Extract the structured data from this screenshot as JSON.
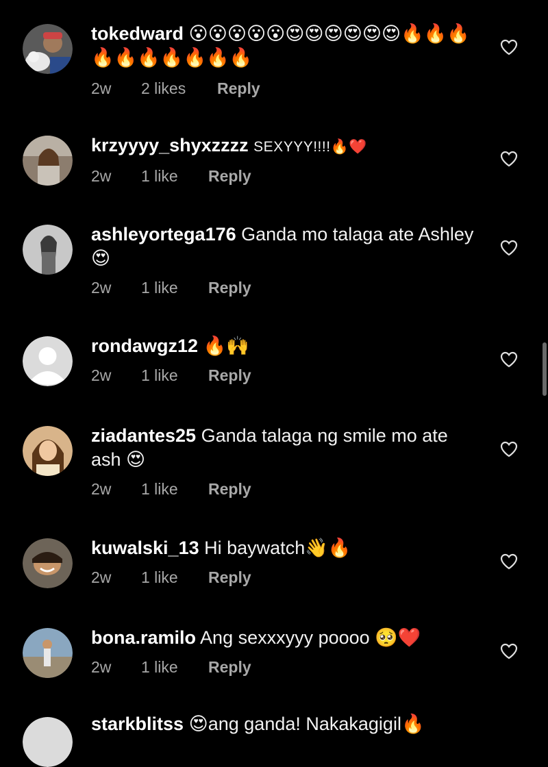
{
  "comments": [
    {
      "username": "tokedward",
      "text": "😮😮😮😮😮😍😍😍😍😍😍🔥🔥🔥🔥🔥🔥🔥🔥🔥🔥",
      "time": "2w",
      "likes": "2 likes",
      "reply": "Reply",
      "avatar_color": "#6b6b6b"
    },
    {
      "username": "krzyyyy_shyxzzzz",
      "text": "SEXYYY!!!!🔥❤️",
      "time": "2w",
      "likes": "1 like",
      "reply": "Reply",
      "avatar_color": "#8c7d6e"
    },
    {
      "username": "ashleyortega176",
      "text": "Ganda mo talaga ate Ashley 😍",
      "time": "2w",
      "likes": "1 like",
      "reply": "Reply",
      "avatar_color": "#9b9b9b"
    },
    {
      "username": "rondawgz12",
      "text": "🔥🙌",
      "time": "2w",
      "likes": "1 like",
      "reply": "Reply",
      "avatar_color": "#dbdbdb"
    },
    {
      "username": "ziadantes25",
      "text": "Ganda talaga ng smile mo ate ash 😍",
      "time": "2w",
      "likes": "1 like",
      "reply": "Reply",
      "avatar_color": "#c79a6a"
    },
    {
      "username": "kuwalski_13",
      "text": "Hi baywatch👋🔥",
      "time": "2w",
      "likes": "1 like",
      "reply": "Reply",
      "avatar_color": "#7a6a5a"
    },
    {
      "username": "bona.ramilo",
      "text": "Ang sexxxyyy poooo 🥺❤️",
      "time": "2w",
      "likes": "1 like",
      "reply": "Reply",
      "avatar_color": "#8aa7c0"
    },
    {
      "username": "starkblitss",
      "text": "😍ang ganda! Nakakagigil🔥",
      "time": "",
      "likes": "",
      "reply": "",
      "avatar_color": "#dbdbdb"
    }
  ],
  "colors": {
    "background": "#000000",
    "text": "#f2f2f2",
    "meta": "#a8a8a8"
  }
}
